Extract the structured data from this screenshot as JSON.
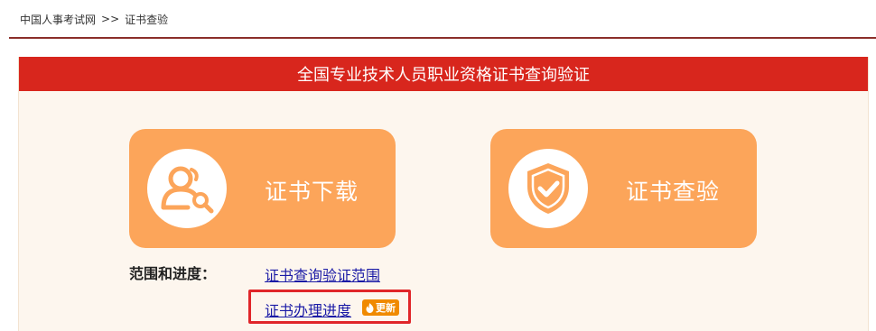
{
  "breadcrumb": {
    "home": "中国人事考试网",
    "separator": ">>",
    "current": "证书查验"
  },
  "panel": {
    "title": "全国专业技术人员职业资格证书查询验证"
  },
  "tiles": {
    "download": {
      "label": "证书下载",
      "icon": "user-search-icon"
    },
    "verify": {
      "label": "证书查验",
      "icon": "shield-check-icon"
    }
  },
  "scope": {
    "heading": "范围和进度：",
    "links": {
      "scope": "证书查询验证范围",
      "progress": "证书办理进度"
    },
    "badge": "更新",
    "badge_icon": "flame-icon"
  },
  "colors": {
    "accent_red": "#d8261d",
    "tile_orange": "#fca55a",
    "badge_orange": "#f08a00",
    "link_blue": "#1a1aa6",
    "highlight_red": "#e0262a"
  }
}
